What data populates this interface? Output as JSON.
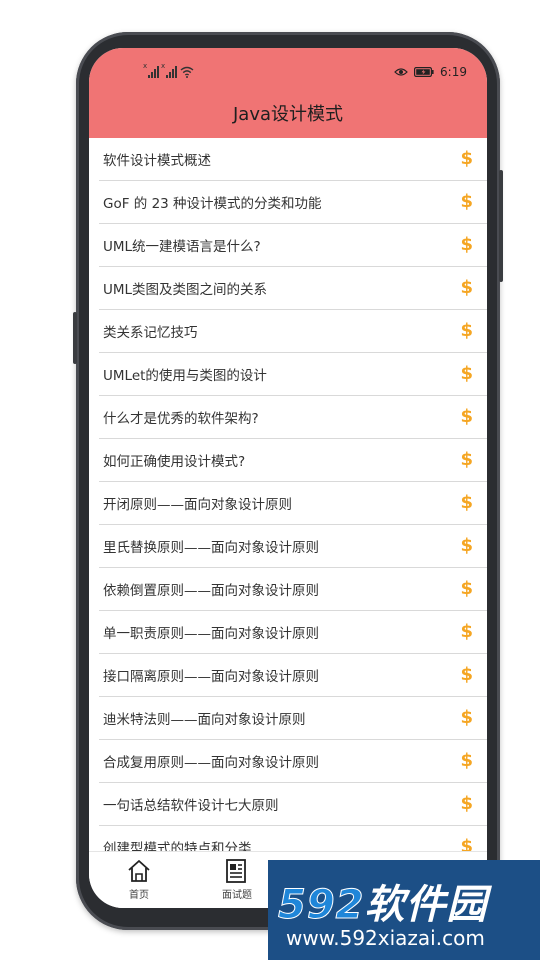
{
  "status_bar": {
    "time": "6:19"
  },
  "app": {
    "title": "Java设计模式"
  },
  "topics": [
    "软件设计模式概述",
    "GoF 的 23 种设计模式的分类和功能",
    "UML统一建模语言是什么?",
    "UML类图及类图之间的关系",
    "类关系记忆技巧",
    "UMLet的使用与类图的设计",
    "什么才是优秀的软件架构?",
    "如何正确使用设计模式?",
    "开闭原则——面向对象设计原则",
    "里氏替换原则——面向对象设计原则",
    "依赖倒置原则——面向对象设计原则",
    "单一职责原则——面向对象设计原则",
    "接口隔离原则——面向对象设计原则",
    "迪米特法则——面向对象设计原则",
    "合成复用原则——面向对象设计原则",
    "一句话总结软件设计七大原则",
    "创建型模式的特点和分类"
  ],
  "topic_badge": "$",
  "tabs": [
    {
      "label": "首页",
      "icon": "home-icon"
    },
    {
      "label": "面试题",
      "icon": "document-icon"
    },
    {
      "label": "",
      "icon": "tools-icon"
    },
    {
      "label": "",
      "icon": "person-icon"
    }
  ],
  "watermark": {
    "brand_num": "592",
    "brand_text": "软件园",
    "url": "www.592xiazai.com"
  },
  "colors": {
    "appbar": "#f07474",
    "badge": "#f5a623",
    "watermark_bg": "#1c4f86"
  }
}
